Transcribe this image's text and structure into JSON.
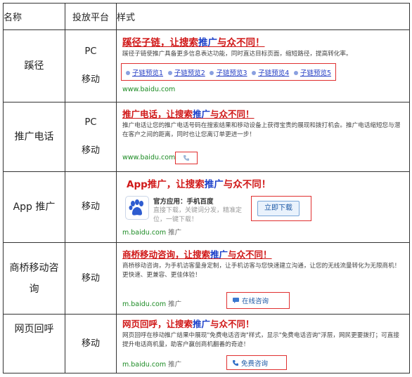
{
  "header": {
    "col1": "名称",
    "col2": "投放平台",
    "col3": "样式"
  },
  "rows": [
    {
      "name": "蹊径",
      "platforms": [
        "PC",
        "移动"
      ],
      "title_red": "蹊径子链，让搜索",
      "title_blue": "推广",
      "title_red2": "与众不同！",
      "desc": "蹊径子链使推广具备更多信息表达功能，同时直达目标页面，缩短路径，提高转化率。",
      "sublinks": [
        "子链预览1",
        "子链预览2",
        "子链预览3",
        "子链预览4",
        "子链预览5"
      ],
      "url": "www.baidu.com"
    },
    {
      "name": "推广电话",
      "platforms": [
        "PC",
        "移动"
      ],
      "title_red": "推广电话，让搜索",
      "title_blue": "推广",
      "title_red2": "与众不同！",
      "desc": "推广电话让您的推广电话号码在搜索结果和移动设备上获得宝贵的展现和拨打机会。推广电话缩短您与潜在客户之间的距离，同时也让您离订单更进一步！",
      "url": "www.baidu.com",
      "icon": "phone-icon"
    },
    {
      "name": "App 推广",
      "platforms": [
        "移动"
      ],
      "title_red": "App推广，让搜索",
      "title_blue": "推广",
      "title_red2": "与众不同！",
      "app_label": "官方应用：手机百度",
      "desc": "直接下载，关键词分发，精准定位，一键下载！",
      "button": "立即下载",
      "url": "m.baidu.com",
      "url_tag": "推广",
      "icon": "baidu-paw-icon"
    },
    {
      "name": "商桥移动咨询",
      "platforms": [
        "移动"
      ],
      "title_red": "商桥移动咨询，让搜索",
      "title_blue": "推广",
      "title_red2": "与众不同！",
      "desc": "商桥移动咨询，为手机访客量身定制，让手机访客与您快速建立沟通，让您的无线流量转化为无限商机！更快速、更兼容、更佳体验！",
      "button": "在线咨询",
      "url": "m.baidu.com",
      "url_tag": "推广",
      "icon": "chat-icon"
    },
    {
      "name": "网页回呼",
      "platforms": [
        "移动"
      ],
      "title_red": "网页回呼，让搜索",
      "title_blue": "推广",
      "title_red2": "与众不同！",
      "desc": "网页回呼在移动推广结果中展现\"免费电话咨询\"样式，显示\"免费电话咨询\"浮层，网民更要拨打；可直接提升电话商机量，助客户赢创商机翻番的奇迹！",
      "button": "免费咨询",
      "url": "m.baidu.com",
      "url_tag": "推广",
      "icon": "phone-icon"
    }
  ],
  "colors": {
    "red": "#d01818",
    "blue": "#1a3fc9",
    "green": "#1a8a22",
    "box": "#e03030"
  }
}
